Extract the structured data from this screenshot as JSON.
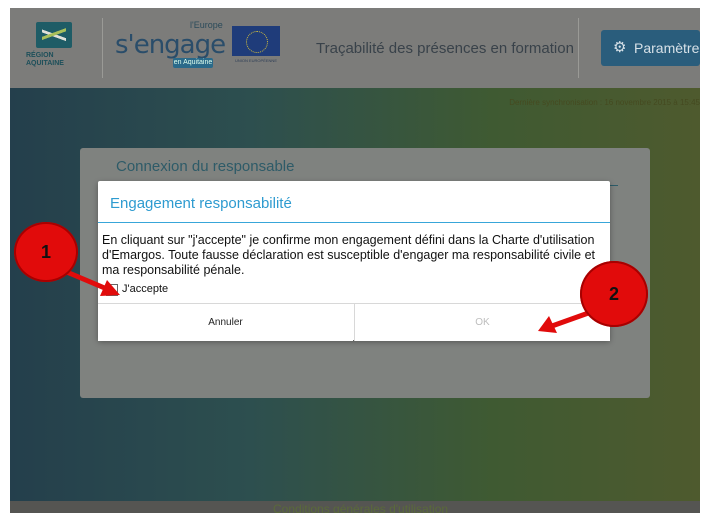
{
  "header": {
    "region_logo_text": "RÉGION AQUITAINE",
    "europe_logo": {
      "top": "l'Europe",
      "main": "s'engage",
      "sub": "en Aquitaine"
    },
    "eu_flag_caption": "UNION EUROPÉENNE",
    "app_title": "Traçabilité des présences en formation",
    "settings_label": "Paramètres"
  },
  "sync_status": "Dernière synchronisation : 16 novembre 2015 à 15:45",
  "login_card": {
    "title": "Connexion du responsable"
  },
  "dialog": {
    "title": "Engagement responsabilité",
    "message": "En cliquant sur \"j'accepte\" je confirme mon engagement défini dans la Charte d'utilisation d'Emargos. Toute fausse déclaration est susceptible d'engager ma responsabilité civile et ma responsabilité pénale.",
    "checkbox_label": "J'accepte",
    "checkbox_checked": false,
    "cancel_label": "Annuler",
    "ok_label": "OK",
    "ok_enabled": false
  },
  "footer_link": "Conditions générales d'utilisation",
  "annotations": [
    {
      "number": "1",
      "target": "accept-checkbox"
    },
    {
      "number": "2",
      "target": "ok-button"
    }
  ],
  "colors": {
    "dialog_accent": "#2e9bd0",
    "marker_red": "#e10b0b",
    "settings_button": "#2a5d7c"
  },
  "icons": [
    "gear-icon",
    "arrow-icon"
  ]
}
